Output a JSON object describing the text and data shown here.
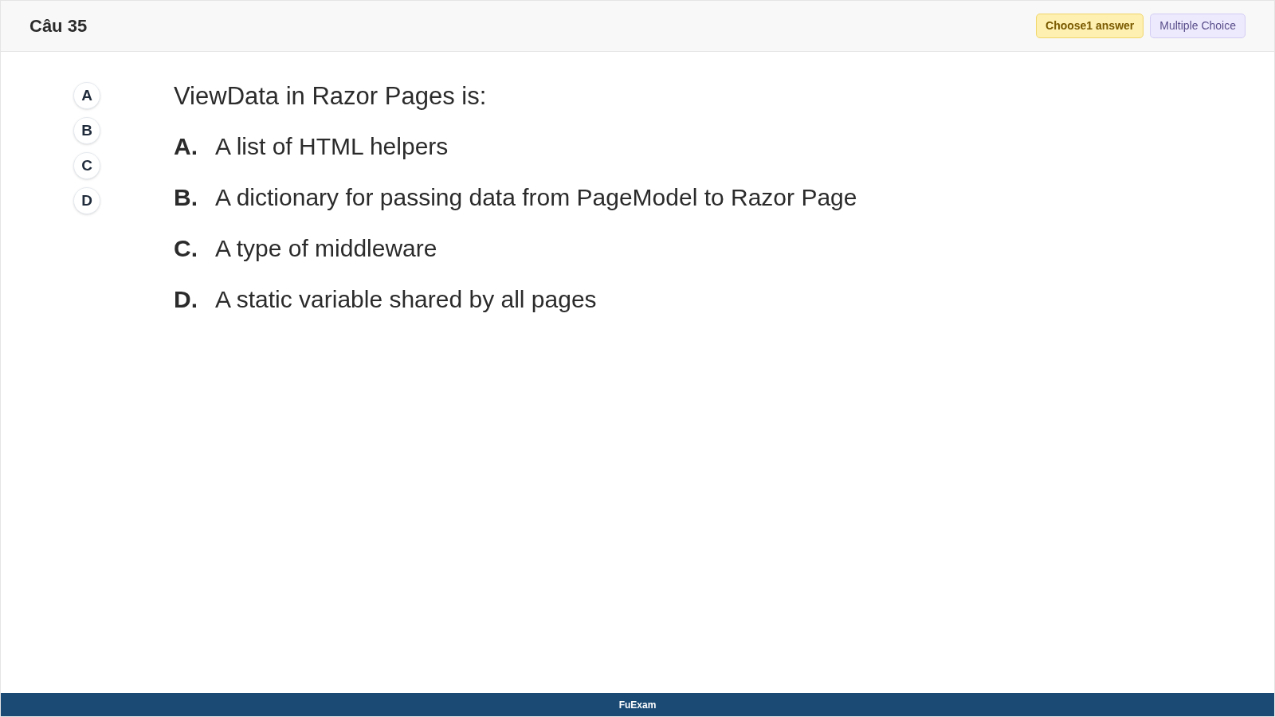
{
  "header": {
    "title": "Câu 35",
    "badges": [
      {
        "kind": "hint",
        "label": "Choose1 answer"
      },
      {
        "kind": "type",
        "label": "Multiple Choice"
      }
    ]
  },
  "answer_bubbles": [
    {
      "label": "A",
      "selected": false
    },
    {
      "label": "B",
      "selected": false
    },
    {
      "label": "C",
      "selected": false
    },
    {
      "label": "D",
      "selected": false
    }
  ],
  "question": "ViewData in Razor Pages is:",
  "options": [
    {
      "letter": "A.",
      "text": "A list of HTML helpers"
    },
    {
      "letter": "B.",
      "text": "A dictionary for passing data from PageModel to Razor Page"
    },
    {
      "letter": "C.",
      "text": "A type of middleware"
    },
    {
      "letter": "D.",
      "text": "A static variable shared by all pages"
    }
  ],
  "footer": {
    "brand": "FuExam"
  }
}
